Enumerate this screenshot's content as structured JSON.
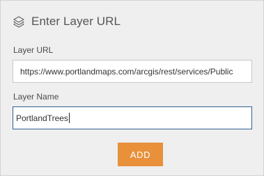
{
  "dialog": {
    "title": "Enter Layer URL",
    "icon": "layers-icon"
  },
  "fields": {
    "url": {
      "label": "Layer URL",
      "value": "https://www.portlandmaps.com/arcgis/rest/services/Public"
    },
    "name": {
      "label": "Layer Name",
      "value": "PortlandTrees"
    }
  },
  "actions": {
    "add_label": "ADD"
  },
  "colors": {
    "accent": "#e8913a",
    "focus_border": "#2e5f8f",
    "panel_bg": "#efefef"
  }
}
